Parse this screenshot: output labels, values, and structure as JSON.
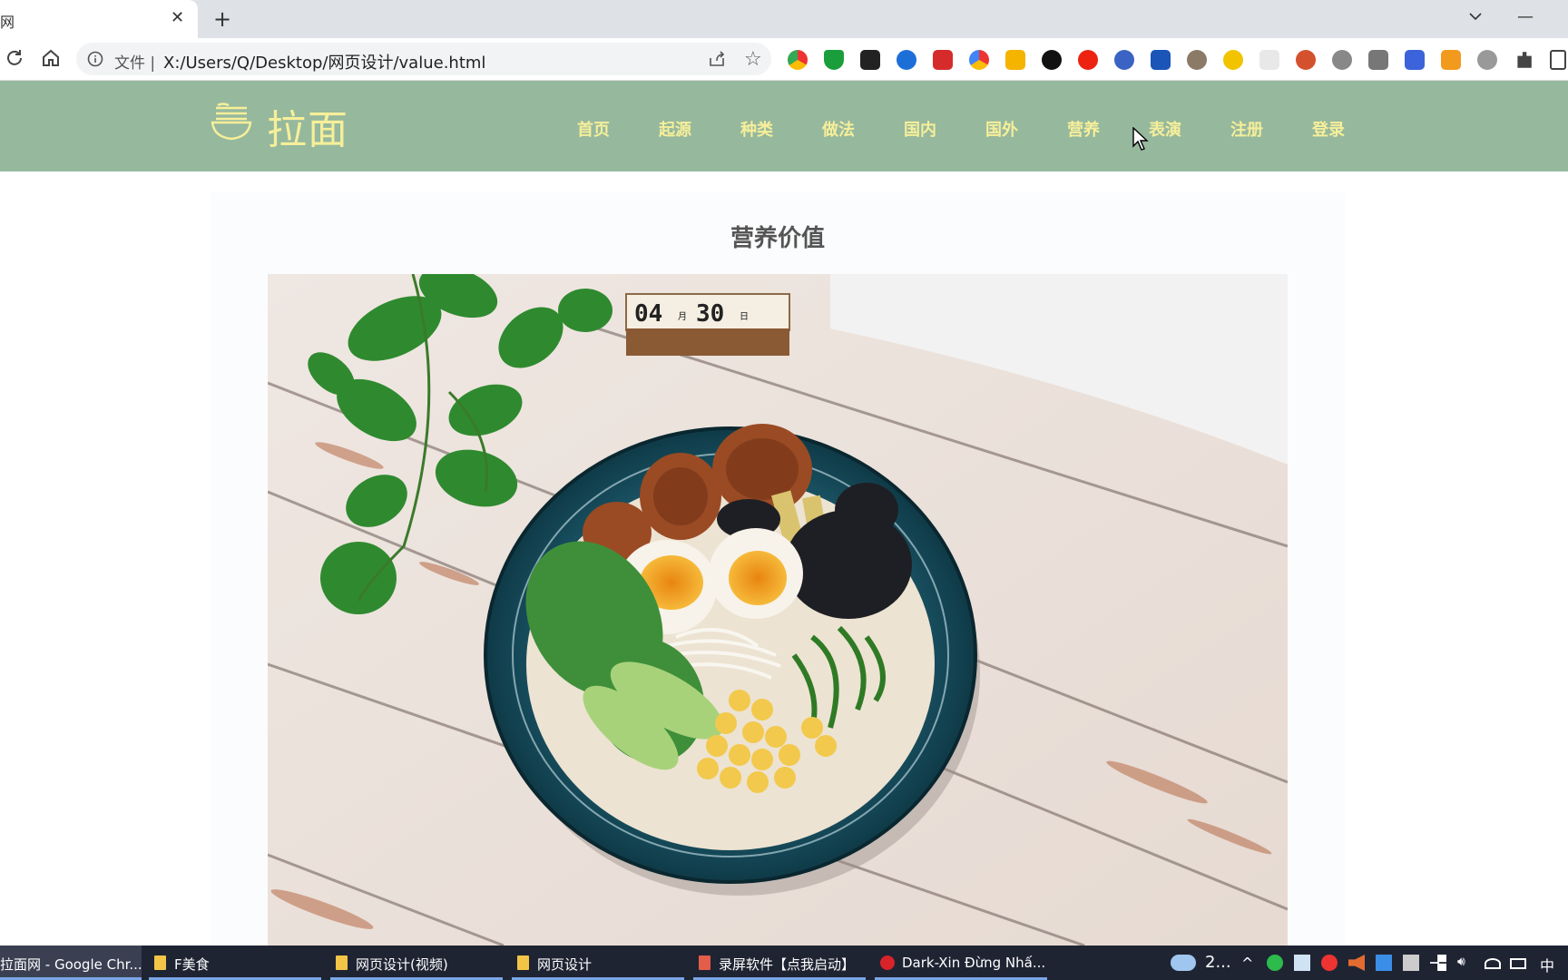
{
  "browser": {
    "tab_title": "网",
    "tab_close": "✕",
    "new_tab": "+",
    "address": {
      "scheme_label": "文件",
      "separator": "|",
      "url": "X:/Users/Q/Desktop/网页设计/value.html"
    }
  },
  "site": {
    "logo_text": "拉面",
    "nav": [
      {
        "label": "首页"
      },
      {
        "label": "起源"
      },
      {
        "label": "种类"
      },
      {
        "label": "做法"
      },
      {
        "label": "国内"
      },
      {
        "label": "国外"
      },
      {
        "label": "营养"
      },
      {
        "label": "表演"
      },
      {
        "label": "注册"
      },
      {
        "label": "登录"
      }
    ],
    "colors": {
      "header_bg": "#96b89d",
      "header_text": "#f6ef9a"
    }
  },
  "content": {
    "section_title": "营养价值",
    "photo": {
      "calendar_month": "04",
      "month_char": "月",
      "calendar_day": "30",
      "day_char": "日"
    }
  },
  "taskbar": {
    "items": [
      {
        "label": "拉面网 - Google Chr..."
      },
      {
        "label": "F美食"
      },
      {
        "label": "网页设计(视频)"
      },
      {
        "label": "网页设计"
      },
      {
        "label": "录屏软件【点我启动】"
      },
      {
        "label": "Dark-Xin Đừng Nhấ..."
      }
    ],
    "weather": "2...",
    "ime": "中"
  }
}
